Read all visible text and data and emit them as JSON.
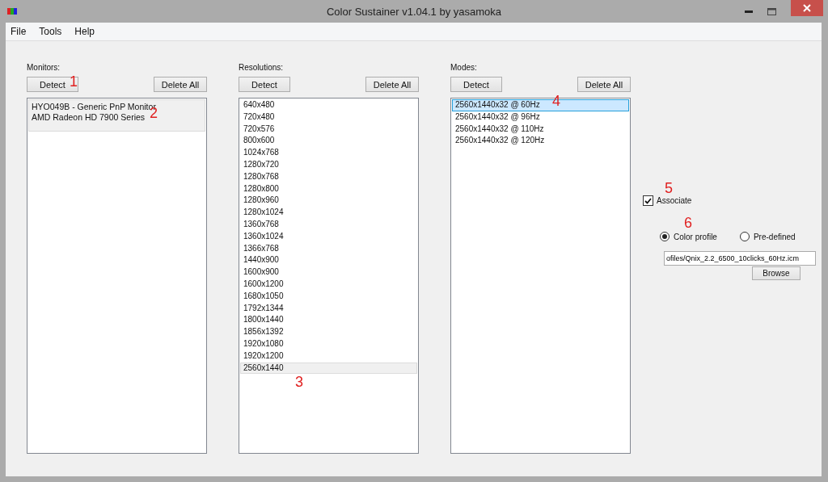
{
  "window": {
    "title": "Color Sustainer v1.04.1 by yasamoka"
  },
  "menu": [
    "File",
    "Tools",
    "Help"
  ],
  "panels": [
    {
      "label": "Monitors:",
      "buttons": [
        "Detect",
        "Delete All"
      ],
      "items": [
        {
          "lines": [
            "HYO049B - Generic PnP Monitor",
            "AMD Radeon HD 7900 Series"
          ],
          "selected": true
        }
      ]
    },
    {
      "label": "Resolutions:",
      "buttons": [
        "Detect",
        "Delete All"
      ],
      "items": [
        {
          "lines": [
            "640x480"
          ],
          "selected": false
        },
        {
          "lines": [
            "720x480"
          ],
          "selected": false
        },
        {
          "lines": [
            "720x576"
          ],
          "selected": false
        },
        {
          "lines": [
            "800x600"
          ],
          "selected": false
        },
        {
          "lines": [
            "1024x768"
          ],
          "selected": false
        },
        {
          "lines": [
            "1280x720"
          ],
          "selected": false
        },
        {
          "lines": [
            "1280x768"
          ],
          "selected": false
        },
        {
          "lines": [
            "1280x800"
          ],
          "selected": false
        },
        {
          "lines": [
            "1280x960"
          ],
          "selected": false
        },
        {
          "lines": [
            "1280x1024"
          ],
          "selected": false
        },
        {
          "lines": [
            "1360x768"
          ],
          "selected": false
        },
        {
          "lines": [
            "1360x1024"
          ],
          "selected": false
        },
        {
          "lines": [
            "1366x768"
          ],
          "selected": false
        },
        {
          "lines": [
            "1440x900"
          ],
          "selected": false
        },
        {
          "lines": [
            "1600x900"
          ],
          "selected": false
        },
        {
          "lines": [
            "1600x1200"
          ],
          "selected": false
        },
        {
          "lines": [
            "1680x1050"
          ],
          "selected": false
        },
        {
          "lines": [
            "1792x1344"
          ],
          "selected": false
        },
        {
          "lines": [
            "1800x1440"
          ],
          "selected": false
        },
        {
          "lines": [
            "1856x1392"
          ],
          "selected": false
        },
        {
          "lines": [
            "1920x1080"
          ],
          "selected": false
        },
        {
          "lines": [
            "1920x1200"
          ],
          "selected": false
        },
        {
          "lines": [
            "2560x1440"
          ],
          "selected": true
        }
      ]
    },
    {
      "label": "Modes:",
      "buttons": [
        "Detect",
        "Delete All"
      ],
      "items": [
        {
          "lines": [
            "2560x1440x32 @ 60Hz"
          ],
          "selected": true
        },
        {
          "lines": [
            "2560x1440x32 @ 96Hz"
          ],
          "selected": false
        },
        {
          "lines": [
            "2560x1440x32 @ 110Hz"
          ],
          "selected": false
        },
        {
          "lines": [
            "2560x1440x32 @ 120Hz"
          ],
          "selected": false
        }
      ]
    }
  ],
  "associate": {
    "label": "Associate",
    "checked": true
  },
  "radios": [
    {
      "label": "Color profile",
      "selected": true
    },
    {
      "label": "Pre-defined",
      "selected": false
    }
  ],
  "profile_path": {
    "value": "ofiles/Qnix_2.2_6500_10clicks_60Hz.icm"
  },
  "browse_button": "Browse",
  "annotations": [
    "1",
    "2",
    "3",
    "4",
    "5",
    "6"
  ]
}
